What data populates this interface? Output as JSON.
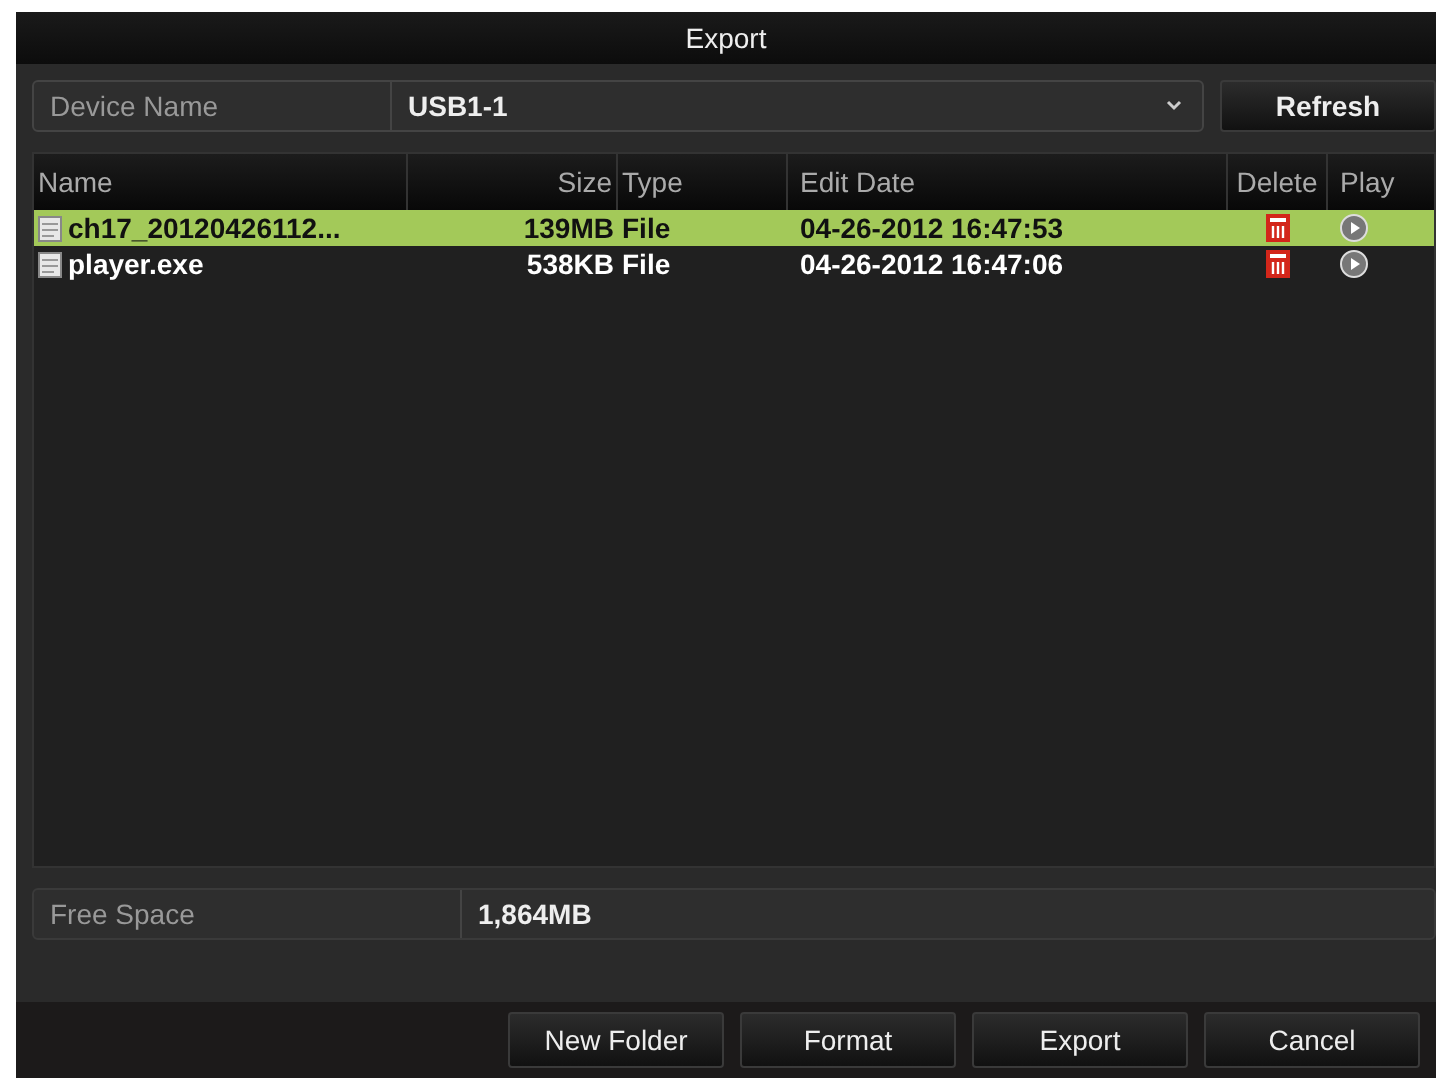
{
  "window": {
    "title": "Export"
  },
  "device": {
    "label": "Device Name",
    "value": "USB1-1",
    "refresh": "Refresh"
  },
  "table": {
    "columns": [
      "Name",
      "Size",
      "Type",
      "Edit Date",
      "Delete",
      "Play"
    ],
    "rows": [
      {
        "name": "ch17_20120426112...",
        "size": "139MB",
        "type": "File",
        "date": "04-26-2012 16:47:53",
        "selected": true
      },
      {
        "name": "player.exe",
        "size": "538KB",
        "type": "File",
        "date": "04-26-2012 16:47:06",
        "selected": false
      }
    ]
  },
  "free_space": {
    "label": "Free Space",
    "value": "1,864MB"
  },
  "buttons": [
    "New Folder",
    "Format",
    "Export",
    "Cancel"
  ]
}
